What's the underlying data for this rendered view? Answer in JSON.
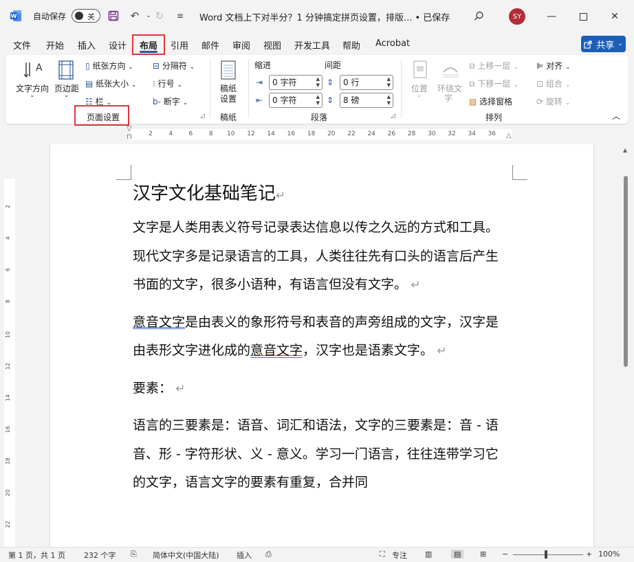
{
  "titlebar": {
    "autosave_label": "自动保存",
    "autosave_state": "关",
    "doc_title": "Word 文档上下对半分？1 分钟搞定拼页设置，排版... • 已保存",
    "avatar_initials": "SY"
  },
  "tabs": [
    "文件",
    "开始",
    "插入",
    "设计",
    "布局",
    "引用",
    "邮件",
    "审阅",
    "视图",
    "开发工具",
    "帮助",
    "Acrobat"
  ],
  "share_label": "共享",
  "ribbon": {
    "page_setup": {
      "text_direction": "文字方向",
      "margins": "页边距",
      "orientation": "纸张方向",
      "size": "纸张大小",
      "columns": "栏",
      "breaks": "分隔符",
      "line_numbers": "行号",
      "hyphenation": "断字",
      "label": "页面设置"
    },
    "manuscript": {
      "button_line1": "稿纸",
      "button_line2": "设置",
      "label": "稿纸"
    },
    "paragraph": {
      "indent_title": "缩进",
      "spacing_title": "间距",
      "indent_left": "0 字符",
      "indent_right": "0 字符",
      "spacing_before": "0 行",
      "spacing_after": "8 磅",
      "label": "段落"
    },
    "arrange": {
      "position": "位置",
      "wrap_line1": "环绕文",
      "wrap_line2": "字",
      "bring_forward": "上移一层",
      "send_backward": "下移一层",
      "selection_pane": "选择窗格",
      "align": "对齐",
      "group": "组合",
      "rotate": "旋转",
      "label": "排列"
    }
  },
  "ruler_h_ticks": [
    "2",
    "4",
    "6",
    "8",
    "10",
    "12",
    "14",
    "16",
    "18",
    "20",
    "22",
    "24",
    "26",
    "28",
    "30",
    "32",
    "34",
    "36"
  ],
  "ruler_v_ticks": [
    "2",
    "4",
    "6",
    "8",
    "10",
    "12",
    "14",
    "16",
    "18",
    "20",
    "22",
    "24"
  ],
  "document": {
    "heading": "汉字文化基础笔记",
    "p1": "文字是人类用表义符号记录表达信息以传之久远的方式和工具。现代文字多是记录语言的工具，人类往往先有口头的语言后产生书面的文字，很多小语种，有语言但没有文字。",
    "p2_a": "意音文字",
    "p2_b": "是由表义的象形符号和表音的声旁组成的文字，汉字是由表形文字进化成的",
    "p2_c": "意音文字",
    "p2_d": "，汉字也是语素文字。",
    "p3": "要素：",
    "p4": "语言的三要素是：语音、词汇和语法，文字的三要素是：音 - 语音、形 - 字符形状、义 - 意义。学习一门语言，往往连带学习它的文字，语言文字的要素有重复，合并同"
  },
  "statusbar": {
    "page": "第 1 页，共 1 页",
    "words": "232 个字",
    "language": "简体中文(中国大陆)",
    "insert": "插入",
    "focus": "专注",
    "zoom": "100%"
  }
}
